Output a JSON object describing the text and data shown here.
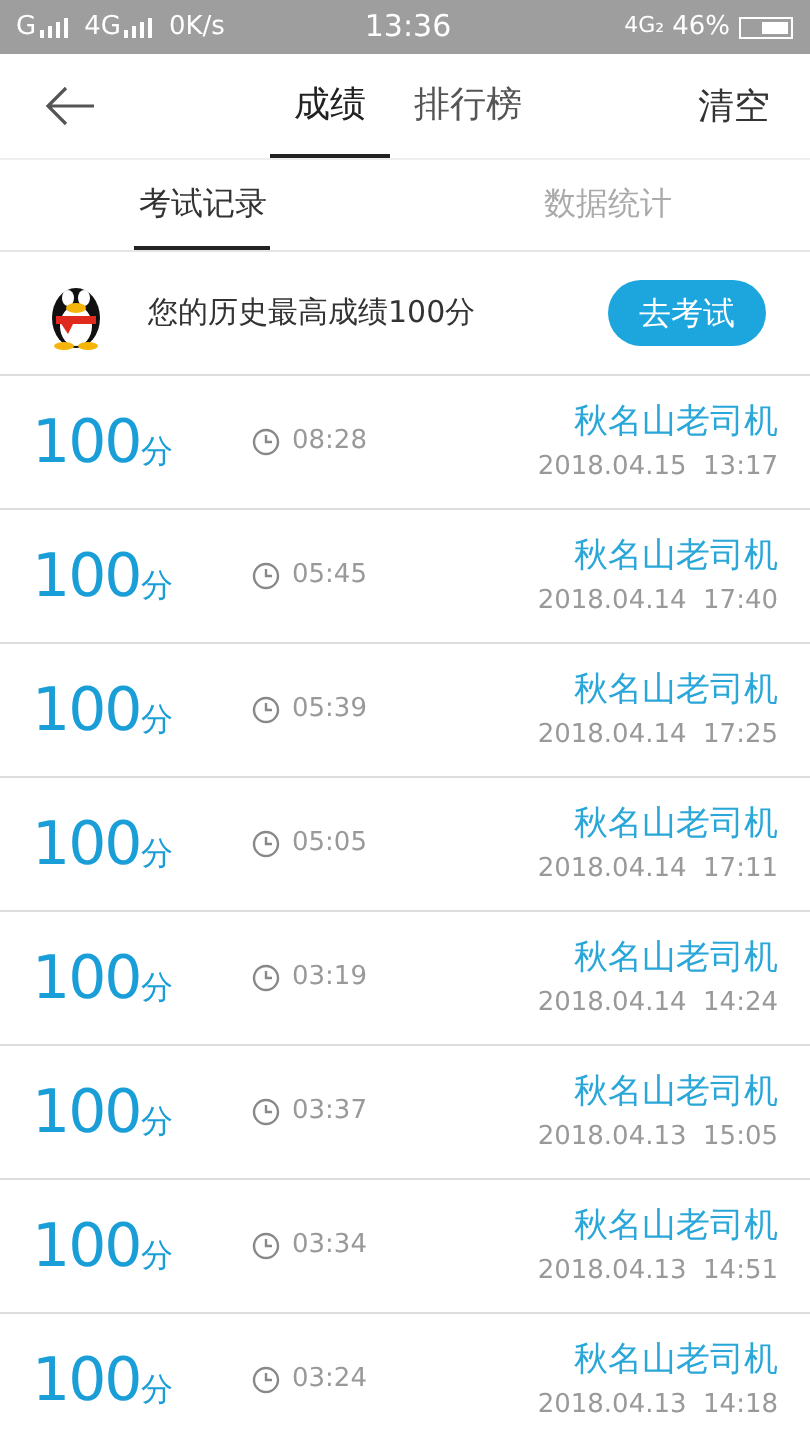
{
  "status_bar": {
    "signal_1": "G",
    "signal_2": "4G",
    "speed": "0K/s",
    "time": "13:36",
    "network": "4G₂",
    "battery": "46%"
  },
  "header": {
    "tabs": [
      {
        "label": "成绩",
        "selected": true
      },
      {
        "label": "排行榜",
        "selected": false
      }
    ],
    "action": "清空"
  },
  "subtabs": [
    {
      "label": "考试记录",
      "selected": true
    },
    {
      "label": "数据统计",
      "selected": false
    }
  ],
  "banner": {
    "text": "您的历史最高成绩100分",
    "button": "去考试"
  },
  "records": [
    {
      "score": "100",
      "unit": "分",
      "duration": "08:28",
      "name": "秋名山老司机",
      "date": "2018.04.15  13:17"
    },
    {
      "score": "100",
      "unit": "分",
      "duration": "05:45",
      "name": "秋名山老司机",
      "date": "2018.04.14  17:40"
    },
    {
      "score": "100",
      "unit": "分",
      "duration": "05:39",
      "name": "秋名山老司机",
      "date": "2018.04.14  17:25"
    },
    {
      "score": "100",
      "unit": "分",
      "duration": "05:05",
      "name": "秋名山老司机",
      "date": "2018.04.14  17:11"
    },
    {
      "score": "100",
      "unit": "分",
      "duration": "03:19",
      "name": "秋名山老司机",
      "date": "2018.04.14  14:24"
    },
    {
      "score": "100",
      "unit": "分",
      "duration": "03:37",
      "name": "秋名山老司机",
      "date": "2018.04.13  15:05"
    },
    {
      "score": "100",
      "unit": "分",
      "duration": "03:34",
      "name": "秋名山老司机",
      "date": "2018.04.13  14:51"
    },
    {
      "score": "100",
      "unit": "分",
      "duration": "03:24",
      "name": "秋名山老司机",
      "date": "2018.04.13  14:18"
    }
  ]
}
